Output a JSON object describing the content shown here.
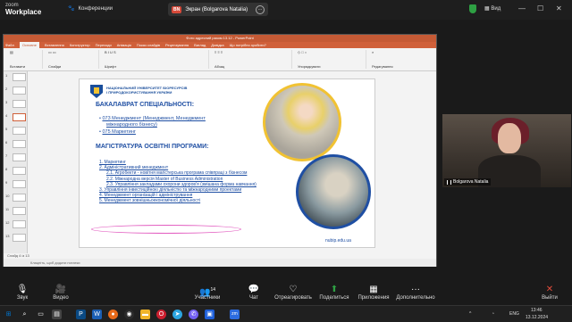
{
  "zoom_top": {
    "brand_small": "zoom",
    "brand_big": "Workplace",
    "meeting_label": "Конференции",
    "share_badge": "BN",
    "share_text": "Экран (Bolgarova Natalia)",
    "more_icon": "more-icon",
    "view_label": "Вид",
    "window_controls": [
      "—",
      "☐",
      "✕"
    ]
  },
  "powerpoint": {
    "title": "Фото адрес​ний разом 13.12 - PowerPoint",
    "tabs": [
      "Файл",
      "Основне",
      "Вставлення",
      "Конструктор",
      "Переходи",
      "Анімація",
      "Показ слайдів",
      "Рецензування",
      "Вигляд",
      "Довідка",
      "Що потрібно зробити?"
    ],
    "ribbon_groups": [
      "Вставити",
      "Слайди",
      "Шрифт",
      "Абзац",
      "Упорядкувати",
      "Редагування"
    ],
    "slide_numbers": [
      "1",
      "2",
      "3",
      "4",
      "5",
      "6",
      "7",
      "8",
      "9",
      "10",
      "11",
      "12",
      "13"
    ],
    "status_left": "Слайд 4 із 13",
    "notes_placeholder": "Клацніть, щоб додати нотатки"
  },
  "slide": {
    "university": [
      "НАЦІОНАЛЬНИЙ УНІВЕРСИТЕТ БІОРЕСУРСІВ",
      "І ПРИРОДОКОРИСТУВАННЯ УКРАЇНИ"
    ],
    "bachelor_heading": "БАКАЛАВРАТ СПЕЦІАЛЬНОСТІ:",
    "bachelor_items": [
      "073 Менеджмент (Менеджмент, Менеджмент",
      "міжнародного бізнесу)",
      "075 Маркетинг"
    ],
    "master_heading": "МАГІСТРАТУРА ОСВІТНІ ПРОГРАМИ:",
    "master_items": [
      "1. Маркетинг",
      "2. Адміністративний менеджмент",
      "2.1. Агробекти - новітня магістерська програма співпраці з бізнесом",
      "2.2. Міжнародна версія Master of Business Administration",
      "2.3. Управління закладами охорони здоров'я (змішана форма навчання)",
      "3. Управління інвестиційною діяльністю та міжнародними проектами",
      "4. Менеджмент організацій і адміністрування",
      "5. Менеджмент зовнішньоекономічної діяльності"
    ],
    "website": "nubip.edu.ua"
  },
  "participant_video": {
    "name": "Bolgarova Natalia"
  },
  "controls": {
    "audio": "Звук",
    "video": "Видео",
    "participants": "Участники",
    "participants_count": "14",
    "chat": "Чат",
    "react": "Отреагировать",
    "share": "Поделиться",
    "apps": "Приложения",
    "more": "Дополнительно",
    "leave": "Выйти"
  },
  "taskbar": {
    "language": "ENG",
    "time": "13:46",
    "date": "13.12.2024"
  },
  "colors": {
    "ppt_accent": "#d0603a",
    "slide_blue": "#1f4fa3",
    "emblem_blue": "#1a4e9b",
    "annotation_ring": "#e25cc0",
    "leave_red": "#e04b3a"
  }
}
